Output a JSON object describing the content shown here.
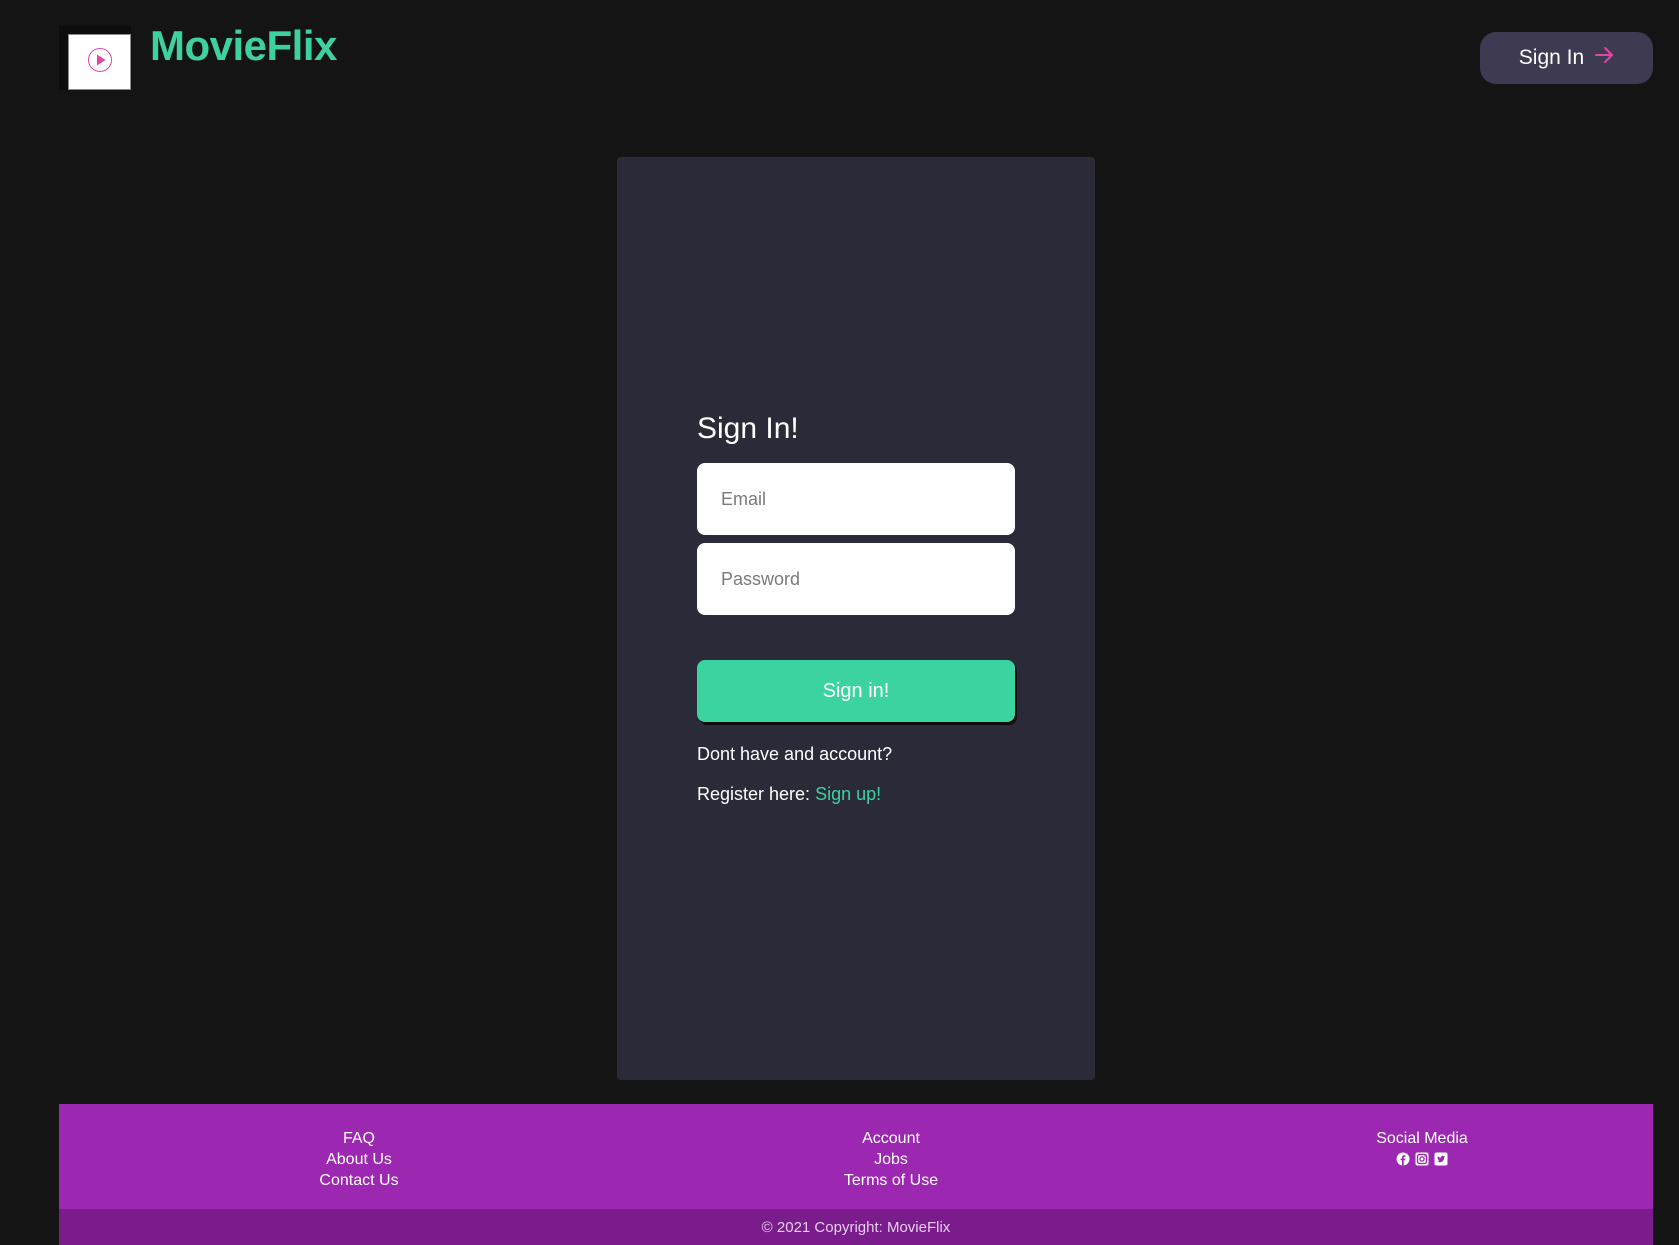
{
  "header": {
    "brand": "MovieFlix",
    "signin_label": "Sign In",
    "logo_icon": "play-circle-icon",
    "signin_icon": "arrow-right-icon"
  },
  "form": {
    "title": "Sign In!",
    "email_placeholder": "Email",
    "password_placeholder": "Password",
    "submit_label": "Sign in!",
    "no_account_text": "Dont have and account?",
    "register_prefix": "Register here:",
    "register_link": "Sign up!"
  },
  "footer": {
    "col1": [
      "FAQ",
      "About Us",
      "Contact Us"
    ],
    "col2": [
      "Account",
      "Jobs",
      "Terms of Use"
    ],
    "social_title": "Social Media",
    "social_icons": [
      "facebook-icon",
      "instagram-icon",
      "twitter-icon"
    ],
    "copyright": "© 2021 Copyright: MovieFlix"
  },
  "colors": {
    "background": "#141414",
    "brand": "#3fd09f",
    "card": "#2b2a38",
    "submit": "#3bd3a0",
    "footer": "#9c27b0",
    "footer_bottom": "#7b1c8c",
    "accent_pink": "#e0479e"
  }
}
